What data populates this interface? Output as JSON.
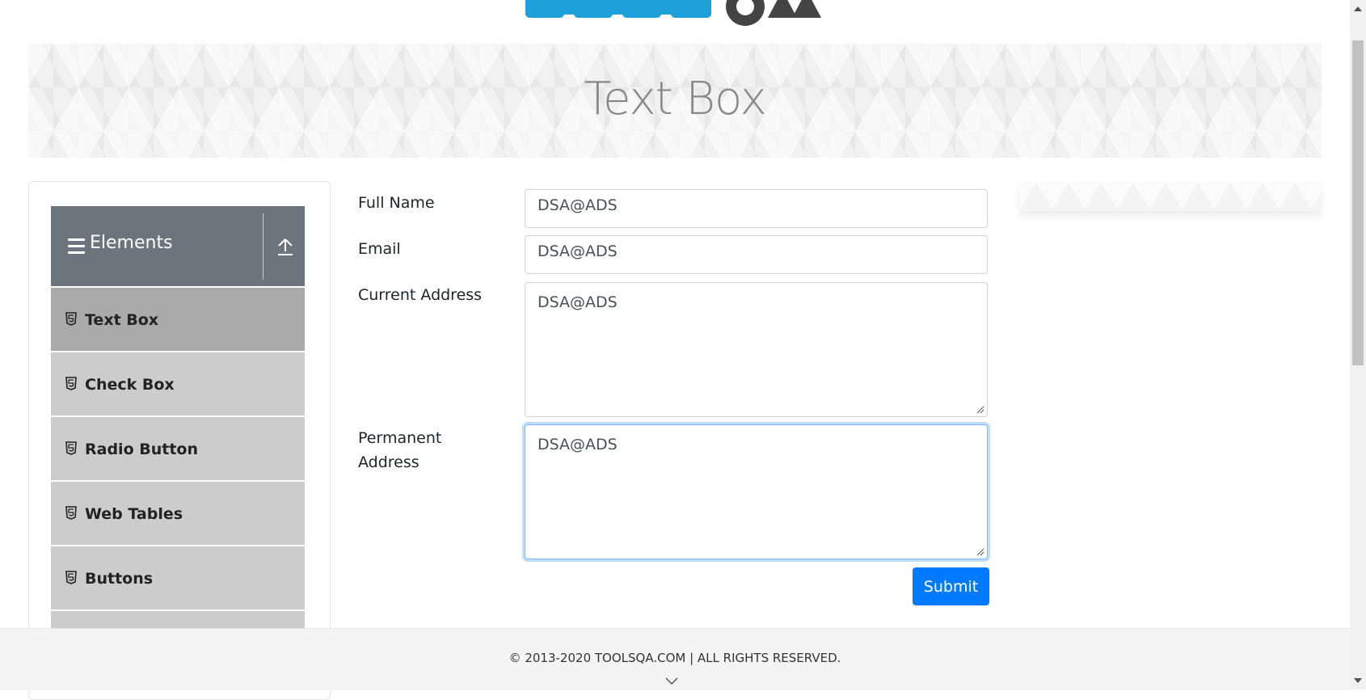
{
  "banner": {
    "title": "Text Box"
  },
  "sidebar": {
    "group_title": "Elements",
    "items": [
      {
        "label": "Text Box",
        "active": true
      },
      {
        "label": "Check Box"
      },
      {
        "label": "Radio Button"
      },
      {
        "label": "Web Tables"
      },
      {
        "label": "Buttons"
      }
    ]
  },
  "form": {
    "full_name": {
      "label": "Full Name",
      "value": "DSA@ADS"
    },
    "email": {
      "label": "Email",
      "value": "DSA@ADS"
    },
    "current_address": {
      "label": "Current Address",
      "value": "DSA@ADS"
    },
    "permanent_address": {
      "label_line1": "Permanent",
      "label_line2": "Address",
      "value": "DSA@ADS"
    },
    "submit_label": "Submit"
  },
  "footer": {
    "text": "© 2013-2020 TOOLSQA.COM | ALL RIGHTS RESERVED."
  },
  "colors": {
    "brand_blue": "#1ea0d8",
    "primary_button": "#007bff",
    "sidebar_header": "#6c757d",
    "menu_item": "#cccccc",
    "menu_item_active": "#aaaaaa"
  }
}
